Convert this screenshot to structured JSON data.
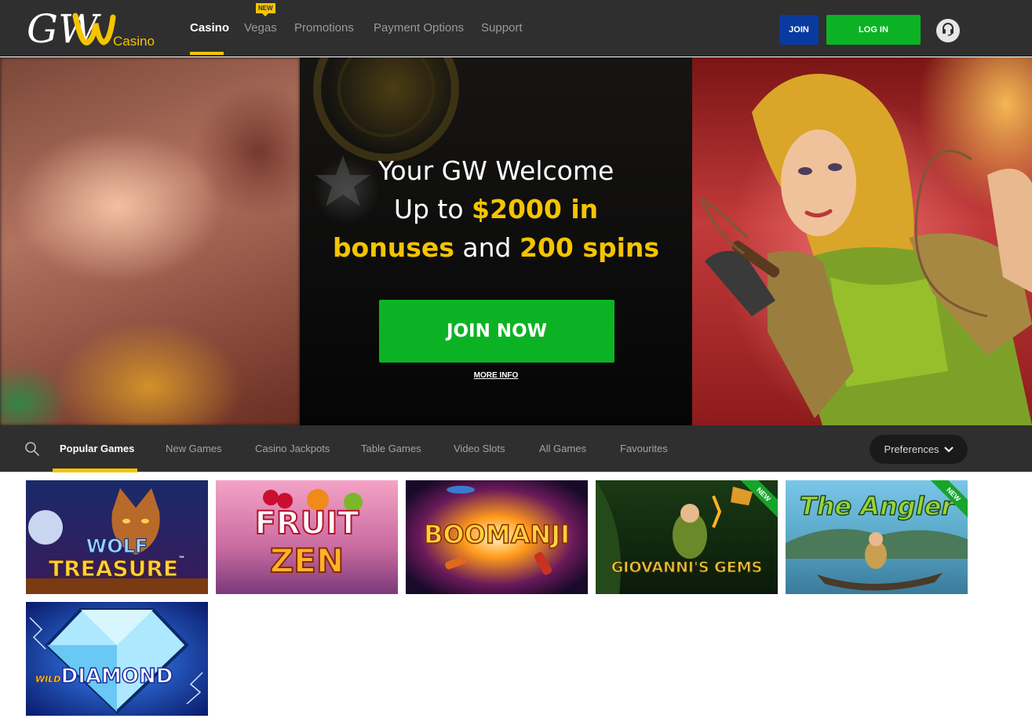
{
  "header": {
    "logo": {
      "letters": "GW",
      "word": "Casino"
    },
    "nav": [
      {
        "label": "Casino",
        "active": true
      },
      {
        "label": "Vegas",
        "badge": "NEW"
      },
      {
        "label": "Promotions"
      },
      {
        "label": "Payment Options"
      },
      {
        "label": "Support"
      }
    ],
    "join_label": "JOIN",
    "login_label": "LOG IN",
    "support_icon": "headset-icon",
    "colors": {
      "bg": "#2f2f2f",
      "accent": "#f5c400",
      "join": "#0a3aa0",
      "login": "#0bb324"
    }
  },
  "hero": {
    "line1": "Your GW Welcome",
    "line2_pre": "Up to ",
    "line2_hl": "$2000 in",
    "line3_hl1": "bonuses",
    "line3_mid": " and ",
    "line3_hl2": "200 spins",
    "cta": "JOIN NOW",
    "more_info": "MORE INFO"
  },
  "categories": {
    "search_icon": "search-icon",
    "items": [
      {
        "label": "Popular Games",
        "active": true
      },
      {
        "label": "New Games"
      },
      {
        "label": "Casino Jackpots"
      },
      {
        "label": "Table Games"
      },
      {
        "label": "Video Slots"
      },
      {
        "label": "All Games"
      },
      {
        "label": "Favourites"
      }
    ],
    "preferences_label": "Preferences",
    "preferences_icon": "chevron-down-icon"
  },
  "games": [
    {
      "title_line1": "WOLF",
      "title_line2": "TREASURE",
      "tm": "™"
    },
    {
      "title_line1": "FRUIT",
      "title_line2": "ZEN"
    },
    {
      "title": "BOOMANJI"
    },
    {
      "title": "GIOVANNI'S GEMS",
      "ribbon": "NEW"
    },
    {
      "title": "The Angler",
      "ribbon": "NEW"
    },
    {
      "title_line1": "WILD",
      "title_line2": "DIAMOND"
    }
  ]
}
